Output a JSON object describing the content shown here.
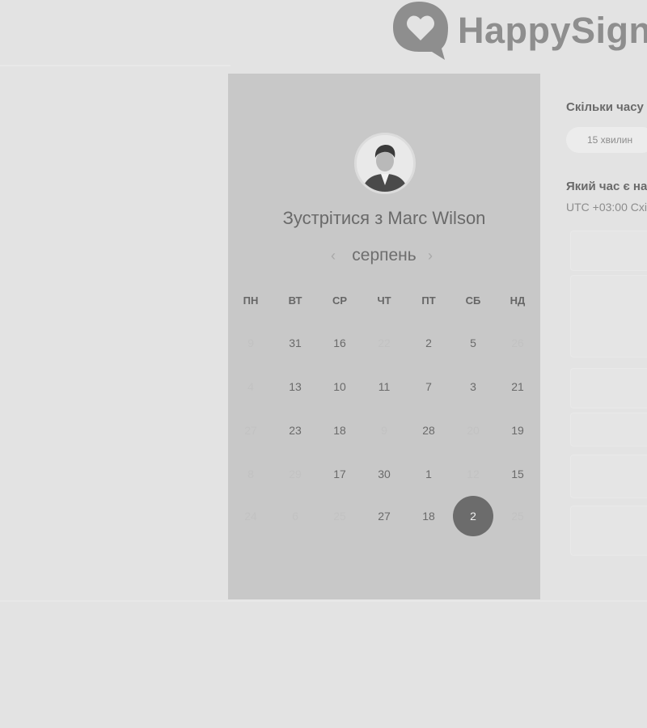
{
  "brand": {
    "logo_text": "HappySigna"
  },
  "booking": {
    "title": "Зустрітися з Marc Wilson",
    "month": "серпень",
    "prev_icon": "chevron-left-icon",
    "next_icon": "chevron-right-icon"
  },
  "calendar": {
    "weekdays": [
      "ПН",
      "ВТ",
      "СР",
      "ЧТ",
      "ПТ",
      "СБ",
      "НД"
    ],
    "weeks": [
      [
        {
          "t": "9",
          "inactive": true
        },
        {
          "t": "31"
        },
        {
          "t": "16"
        },
        {
          "t": "22",
          "inactive": true
        },
        {
          "t": "2"
        },
        {
          "t": "5"
        },
        {
          "t": "26",
          "inactive": true
        }
      ],
      [
        {
          "t": "4",
          "inactive": true
        },
        {
          "t": "13"
        },
        {
          "t": "10"
        },
        {
          "t": "11"
        },
        {
          "t": "7"
        },
        {
          "t": "3"
        },
        {
          "t": "21"
        }
      ],
      [
        {
          "t": "27",
          "inactive": true
        },
        {
          "t": "23"
        },
        {
          "t": "18"
        },
        {
          "t": "9",
          "inactive": true
        },
        {
          "t": "28"
        },
        {
          "t": "20",
          "inactive": true
        },
        {
          "t": "19"
        }
      ],
      [
        {
          "t": "8",
          "inactive": true
        },
        {
          "t": "29",
          "inactive": true
        },
        {
          "t": "17"
        },
        {
          "t": "30"
        },
        {
          "t": "1"
        },
        {
          "t": "12",
          "inactive": true
        },
        {
          "t": "15"
        }
      ],
      [
        {
          "t": "24",
          "inactive": true
        },
        {
          "t": "6",
          "inactive": true
        },
        {
          "t": "25",
          "inactive": true
        },
        {
          "t": "27"
        },
        {
          "t": "18"
        },
        {
          "t": "2",
          "selected": true
        },
        {
          "t": "25",
          "inactive": true
        }
      ]
    ]
  },
  "sidebar": {
    "duration_question": "Скільки часу",
    "duration_option": "15 хвилин",
    "time_question": "Який час є на",
    "timezone": "UTC +03:00 Схі"
  }
}
